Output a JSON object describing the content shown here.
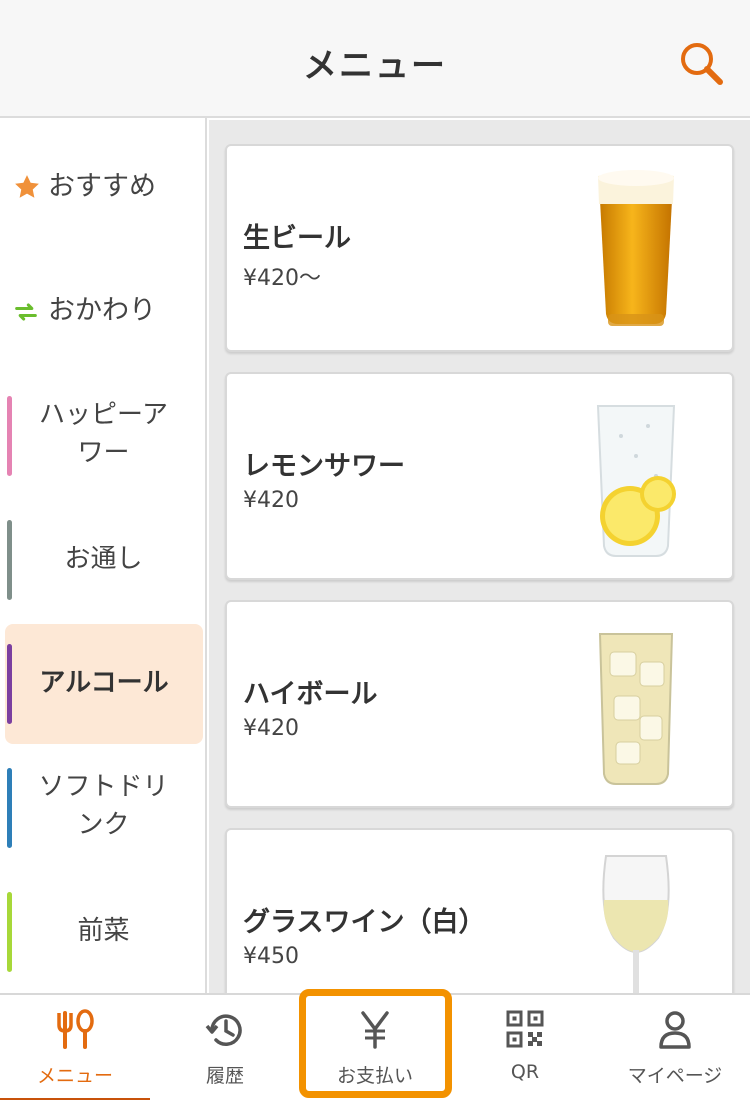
{
  "header": {
    "title": "メニュー"
  },
  "categories": [
    {
      "label": "おすすめ",
      "icon": "star-icon"
    },
    {
      "label": "おかわり",
      "icon": "refill-icon"
    },
    {
      "label": "ハッピーア\nワー",
      "bar_color": "#e583b3"
    },
    {
      "label": "お通し",
      "bar_color": "#7f8f8a"
    },
    {
      "label": "アルコール",
      "bar_color": "#7b3fa0",
      "active": true
    },
    {
      "label": "ソフトドリ\nンク",
      "bar_color": "#2e7fb8"
    },
    {
      "label": "前菜",
      "bar_color": "#a7d839"
    }
  ],
  "items": [
    {
      "name": "生ビール",
      "price": "¥420〜",
      "image": "beer-glass"
    },
    {
      "name": "レモンサワー",
      "price": "¥420",
      "image": "lemon-sour-glass"
    },
    {
      "name": "ハイボール",
      "price": "¥420",
      "image": "highball-glass"
    },
    {
      "name": "グラスワイン（白）",
      "price": "¥450",
      "image": "white-wine-glass"
    }
  ],
  "nav": [
    {
      "label": "メニュー",
      "icon": "cutlery-icon",
      "active": true
    },
    {
      "label": "履歴",
      "icon": "history-icon"
    },
    {
      "label": "お支払い",
      "icon": "yen-icon",
      "highlighted": true
    },
    {
      "label": "QR",
      "icon": "qr-icon"
    },
    {
      "label": "マイページ",
      "icon": "person-icon"
    }
  ],
  "colors": {
    "accent": "#e36b10",
    "highlight": "#f39200",
    "active_bg": "#fde8d6"
  }
}
